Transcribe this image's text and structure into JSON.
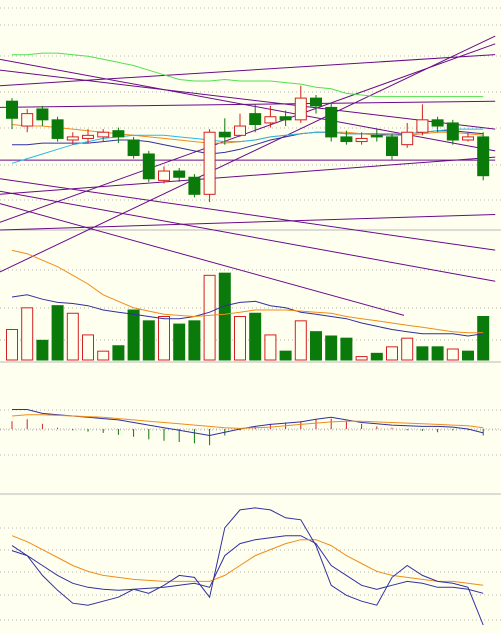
{
  "colors": {
    "background": "#FFFFF0",
    "up_candle": "#D42020",
    "down_candle": "#0A7A0A",
    "ma_fast": "#3030A0",
    "ma_slow": "#F08C1A",
    "bollinger": "#2AB7E8",
    "long_ma": "#50E050",
    "trendline": "#6A0A8A",
    "grid": "#A0A0A0",
    "separator": "#B8B8B8"
  },
  "chart_data": [
    {
      "type": "candlestick",
      "panel": "price",
      "x": [
        0,
        1,
        2,
        3,
        4,
        5,
        6,
        7,
        8,
        9,
        10,
        11,
        12,
        13,
        14,
        15,
        16,
        17,
        18,
        19,
        20,
        21,
        22,
        23,
        24,
        25,
        26,
        27,
        28,
        29,
        30,
        31
      ],
      "ylim": [
        0,
        100
      ],
      "candles": [
        {
          "o": 78,
          "c": 67,
          "h": 80,
          "l": 60
        },
        {
          "o": 62,
          "c": 70,
          "h": 73,
          "l": 58
        },
        {
          "o": 73,
          "c": 66,
          "h": 75,
          "l": 62
        },
        {
          "o": 66,
          "c": 54,
          "h": 68,
          "l": 52
        },
        {
          "o": 53,
          "c": 55,
          "h": 58,
          "l": 50
        },
        {
          "o": 54,
          "c": 56,
          "h": 60,
          "l": 51
        },
        {
          "o": 55,
          "c": 58,
          "h": 60,
          "l": 52
        },
        {
          "o": 59,
          "c": 55,
          "h": 61,
          "l": 51
        },
        {
          "o": 53,
          "c": 43,
          "h": 55,
          "l": 41
        },
        {
          "o": 44,
          "c": 28,
          "h": 46,
          "l": 26
        },
        {
          "o": 27,
          "c": 33,
          "h": 36,
          "l": 25
        },
        {
          "o": 33,
          "c": 29,
          "h": 35,
          "l": 26
        },
        {
          "o": 29,
          "c": 18,
          "h": 31,
          "l": 16
        },
        {
          "o": 18,
          "c": 58,
          "h": 60,
          "l": 13
        },
        {
          "o": 58,
          "c": 55,
          "h": 67,
          "l": 50
        },
        {
          "o": 56,
          "c": 62,
          "h": 70,
          "l": 55
        },
        {
          "o": 70,
          "c": 63,
          "h": 76,
          "l": 58
        },
        {
          "o": 64,
          "c": 68,
          "h": 75,
          "l": 61
        },
        {
          "o": 68,
          "c": 66,
          "h": 72,
          "l": 62
        },
        {
          "o": 66,
          "c": 80,
          "h": 88,
          "l": 64
        },
        {
          "o": 80,
          "c": 75,
          "h": 82,
          "l": 70
        },
        {
          "o": 74,
          "c": 55,
          "h": 77,
          "l": 52
        },
        {
          "o": 55,
          "c": 52,
          "h": 59,
          "l": 50
        },
        {
          "o": 52,
          "c": 54,
          "h": 58,
          "l": 50
        },
        {
          "o": 56,
          "c": 55,
          "h": 60,
          "l": 52
        },
        {
          "o": 55,
          "c": 43,
          "h": 57,
          "l": 40
        },
        {
          "o": 50,
          "c": 58,
          "h": 64,
          "l": 48
        },
        {
          "o": 58,
          "c": 66,
          "h": 76,
          "l": 56
        },
        {
          "o": 66,
          "c": 62,
          "h": 68,
          "l": 58
        },
        {
          "o": 64,
          "c": 53,
          "h": 66,
          "l": 50
        },
        {
          "o": 53,
          "c": 55,
          "h": 58,
          "l": 52
        },
        {
          "o": 55,
          "c": 30,
          "h": 58,
          "l": 27
        }
      ],
      "series": [
        {
          "color_key": "ma_fast",
          "values": [
            50,
            50,
            51,
            51,
            51,
            51,
            52,
            53,
            53,
            52,
            50,
            48,
            46,
            44,
            45,
            47,
            50,
            53,
            55,
            57,
            58,
            58,
            57,
            57,
            57,
            56,
            57,
            58,
            59,
            59,
            58,
            57
          ]
        },
        {
          "color_key": "ma_slow",
          "values": [
            63,
            62,
            62,
            61,
            60,
            59,
            58,
            57,
            56,
            55,
            54,
            53,
            52,
            51,
            51,
            52,
            53,
            55,
            56,
            57,
            58,
            58,
            58,
            57,
            56,
            56,
            56,
            57,
            58,
            58,
            57,
            56
          ]
        },
        {
          "color_key": "bollinger",
          "values": [
            38,
            41,
            44,
            47,
            50,
            52,
            54,
            55,
            56,
            56,
            56,
            55,
            54,
            53,
            52,
            52,
            53,
            55,
            56,
            57,
            58,
            58,
            57,
            57,
            57,
            57,
            57,
            58,
            59,
            60,
            60,
            60
          ]
        },
        {
          "color_key": "long_ma",
          "values": [
            108,
            108,
            109,
            109,
            108,
            107,
            105,
            103,
            101,
            98,
            95,
            92,
            91,
            91,
            92,
            91,
            91,
            91,
            90,
            89,
            87,
            86,
            83,
            82,
            81,
            81,
            81,
            81,
            81,
            81,
            81,
            81
          ]
        }
      ],
      "trendlines": [
        {
          "from": [
            0,
            0
          ],
          "to": [
            31,
            115
          ]
        },
        {
          "from": [
            0,
            28
          ],
          "to": [
            31,
            -18
          ]
        },
        {
          "from": [
            0,
            20
          ],
          "to": [
            31,
            -38
          ]
        },
        {
          "from": [
            0,
            -32
          ],
          "to": [
            31,
            120
          ]
        },
        {
          "from": [
            0,
            105
          ],
          "to": [
            31,
            46
          ]
        },
        {
          "from": [
            0,
            98
          ],
          "to": [
            31,
            60
          ]
        },
        {
          "from": [
            0,
            88
          ],
          "to": [
            31,
            108
          ]
        },
        {
          "from": [
            0,
            74
          ],
          "to": [
            31,
            78
          ]
        },
        {
          "from": [
            0,
            40
          ],
          "to": [
            31,
            40
          ]
        },
        {
          "from": [
            0,
            -5
          ],
          "to": [
            31,
            5
          ]
        },
        {
          "from": [
            0,
            18
          ],
          "to": [
            31,
            42
          ]
        },
        {
          "from": [
            0,
            12
          ],
          "to": [
            25,
            -60
          ]
        }
      ]
    },
    {
      "type": "bar",
      "panel": "volume",
      "ylim": [
        0,
        100
      ],
      "values": [
        30,
        50,
        20,
        52,
        45,
        25,
        10,
        15,
        48,
        38,
        42,
        35,
        38,
        80,
        82,
        42,
        45,
        25,
        10,
        38,
        28,
        24,
        22,
        5,
        8,
        14,
        22,
        14,
        14,
        12,
        10,
        42
      ],
      "up": [
        true,
        true,
        false,
        false,
        true,
        true,
        true,
        false,
        false,
        false,
        true,
        false,
        false,
        true,
        false,
        true,
        false,
        true,
        false,
        true,
        false,
        false,
        false,
        true,
        false,
        true,
        true,
        false,
        false,
        true,
        false,
        false
      ],
      "series": [
        {
          "color_key": "ma_fast",
          "values": [
            60,
            62,
            58,
            55,
            54,
            52,
            48,
            46,
            44,
            42,
            40,
            40,
            42,
            46,
            52,
            55,
            56,
            52,
            50,
            46,
            44,
            42,
            40,
            36,
            33,
            30,
            28,
            26,
            26,
            26,
            24,
            26
          ]
        },
        {
          "color_key": "ma_slow",
          "values": [
            103,
            100,
            94,
            88,
            80,
            72,
            62,
            56,
            50,
            47,
            44,
            43,
            42,
            43,
            44,
            46,
            48,
            48,
            48,
            47,
            46,
            45,
            42,
            40,
            38,
            36,
            34,
            32,
            30,
            28,
            27,
            27
          ]
        }
      ]
    },
    {
      "type": "bar",
      "panel": "macd",
      "ylim": [
        -100,
        100
      ],
      "values": [
        12,
        15,
        8,
        2,
        -2,
        -4,
        -6,
        -9,
        -12,
        -16,
        -18,
        -20,
        -22,
        -25,
        -10,
        -2,
        4,
        8,
        10,
        12,
        15,
        16,
        12,
        8,
        4,
        2,
        -2,
        -3,
        -5,
        -2,
        -2,
        -10
      ],
      "series": [
        {
          "color_key": "ma_fast",
          "values": [
            30,
            30,
            24,
            22,
            20,
            18,
            16,
            14,
            10,
            6,
            2,
            -2,
            -6,
            -10,
            -5,
            0,
            4,
            7,
            9,
            11,
            15,
            18,
            14,
            10,
            8,
            6,
            5,
            4,
            4,
            3,
            0,
            -6
          ]
        },
        {
          "color_key": "ma_slow",
          "values": [
            20,
            22,
            22,
            21,
            20,
            19,
            18,
            16,
            14,
            12,
            10,
            8,
            6,
            4,
            2,
            1,
            2,
            3,
            5,
            7,
            9,
            11,
            12,
            12,
            11,
            10,
            9,
            8,
            7,
            6,
            5,
            2
          ]
        }
      ]
    },
    {
      "type": "line",
      "panel": "kdj",
      "ylim": [
        0,
        100
      ],
      "series": [
        {
          "color_key": "ma_fast",
          "values": [
            55,
            50,
            40,
            30,
            22,
            18,
            16,
            15,
            16,
            17,
            18,
            20,
            22,
            18,
            50,
            62,
            66,
            68,
            70,
            70,
            62,
            40,
            30,
            20,
            16,
            20,
            24,
            22,
            18,
            18,
            16,
            12
          ]
        },
        {
          "color_key": "ma_slow",
          "values": [
            70,
            64,
            56,
            48,
            40,
            34,
            30,
            28,
            26,
            25,
            24,
            24,
            24,
            24,
            30,
            40,
            50,
            56,
            62,
            66,
            66,
            60,
            50,
            42,
            34,
            30,
            28,
            26,
            24,
            24,
            22,
            20
          ]
        },
        {
          "color_key": "ma_fast",
          "values": [
            60,
            50,
            30,
            15,
            2,
            0,
            4,
            8,
            16,
            12,
            20,
            30,
            28,
            8,
            78,
            96,
            98,
            96,
            88,
            86,
            60,
            20,
            10,
            4,
            0,
            28,
            40,
            30,
            24,
            22,
            18,
            -20
          ]
        }
      ]
    }
  ]
}
